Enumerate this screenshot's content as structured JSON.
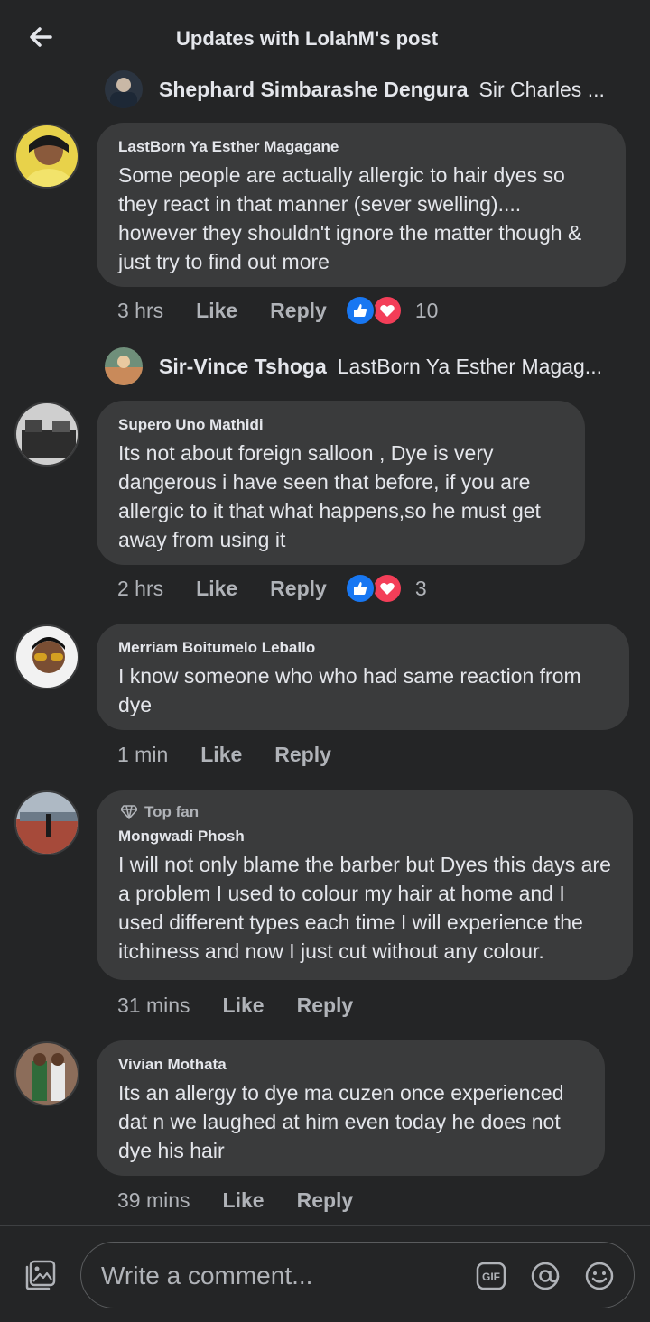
{
  "header": {
    "title": "Updates with LolahM's post",
    "back_icon": "arrow-left-icon"
  },
  "replies_preview": [
    {
      "name": "Shephard Simbarashe Dengura",
      "text": "Sir Charles  ..."
    },
    {
      "name": "Sir-Vince Tshoga",
      "text": "LastBorn Ya Esther Magag..."
    }
  ],
  "comments": [
    {
      "author": "LastBorn Ya Esther Magagane",
      "text": "Some people are actually allergic to hair dyes so they react in that manner (sever swelling).... however they shouldn't ignore the matter though & just try to find out more",
      "time": "3 hrs",
      "like": "Like",
      "reply": "Reply",
      "reactions": "10"
    },
    {
      "author": "Supero Uno Mathidi",
      "text": "Its not about foreign salloon , Dye is very dangerous i have seen that  before, if you are allergic to it that what happens,so he must get away from using it",
      "time": "2 hrs",
      "like": "Like",
      "reply": "Reply",
      "reactions": "3"
    },
    {
      "author": "Merriam Boitumelo Leballo",
      "text": "I know someone who who had same reaction from dye",
      "time": "1 min",
      "like": "Like",
      "reply": "Reply"
    },
    {
      "badge": "Top fan",
      "author": "Mongwadi Phosh",
      "text": "I will not only blame the barber but Dyes this days are a problem I used to colour my hair at home and I used different types each time I will experience the itchiness and now I just cut without any colour.",
      "time": "31 mins",
      "like": "Like",
      "reply": "Reply"
    },
    {
      "author": "Vivian Mothata",
      "text": "Its an allergy to dye ma cuzen once experienced dat n we laughed at him even today he does not dye his hair",
      "time": "39 mins",
      "like": "Like",
      "reply": "Reply"
    }
  ],
  "composer": {
    "placeholder": "Write a comment...",
    "gif_label": "GIF"
  },
  "colors": {
    "background": "#242526",
    "bubble": "#3a3b3c",
    "like_blue": "#1877f2",
    "love_red": "#f33e58",
    "muted_text": "#b0b3b8"
  }
}
